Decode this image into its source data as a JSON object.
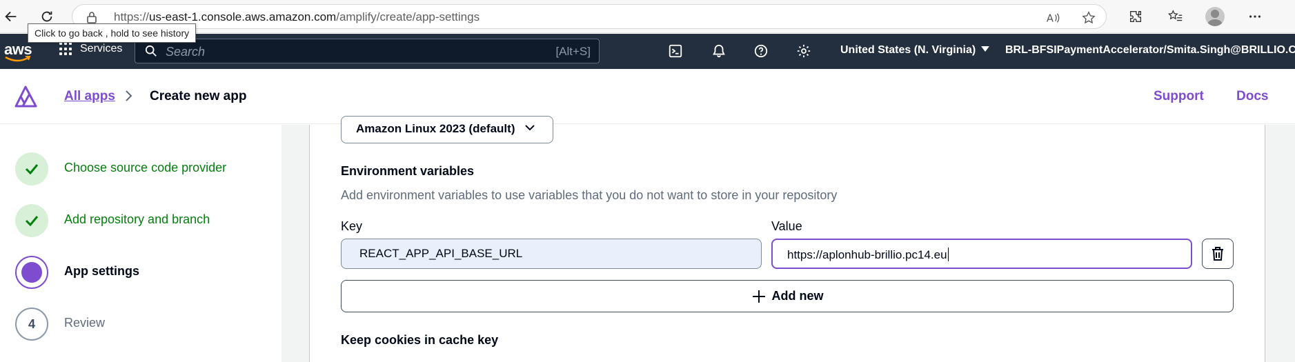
{
  "browser": {
    "url_prefix": "https://",
    "url_host": "us-east-1.console.aws.amazon.com",
    "url_path": "/amplify/create/app-settings",
    "back_tooltip": "Click to go back , hold to see history"
  },
  "aws_nav": {
    "logo": "aws",
    "services_label": "Services",
    "search_placeholder": "Search",
    "search_shortcut": "[Alt+S]",
    "region": "United States (N. Virginia)",
    "account": "BRL-BFSIPaymentAccelerator/Smita.Singh@BRILLIO.COM"
  },
  "header": {
    "breadcrumb_link": "All apps",
    "breadcrumb_current": "Create new app",
    "support": "Support",
    "docs": "Docs"
  },
  "steps": [
    {
      "label": "Choose source code provider",
      "state": "done"
    },
    {
      "label": "Add repository and branch",
      "state": "done"
    },
    {
      "label": "App settings",
      "state": "active"
    },
    {
      "label": "Review",
      "state": "pending",
      "number": "4"
    }
  ],
  "build_image": {
    "selected": "Amazon Linux 2023 (default)"
  },
  "env_vars": {
    "title": "Environment variables",
    "description": "Add environment variables to use variables that you do not want to store in your repository",
    "key_label": "Key",
    "value_label": "Value",
    "key": "REACT_APP_API_BASE_URL",
    "value": "https://aplonhub-brillio.pc14.eu",
    "add_new": "Add new"
  },
  "cookies": {
    "title": "Keep cookies in cache key"
  },
  "colors": {
    "accent": "#7d4ccf",
    "success": "#037f0c",
    "aws_nav_bg": "#232f3e"
  }
}
